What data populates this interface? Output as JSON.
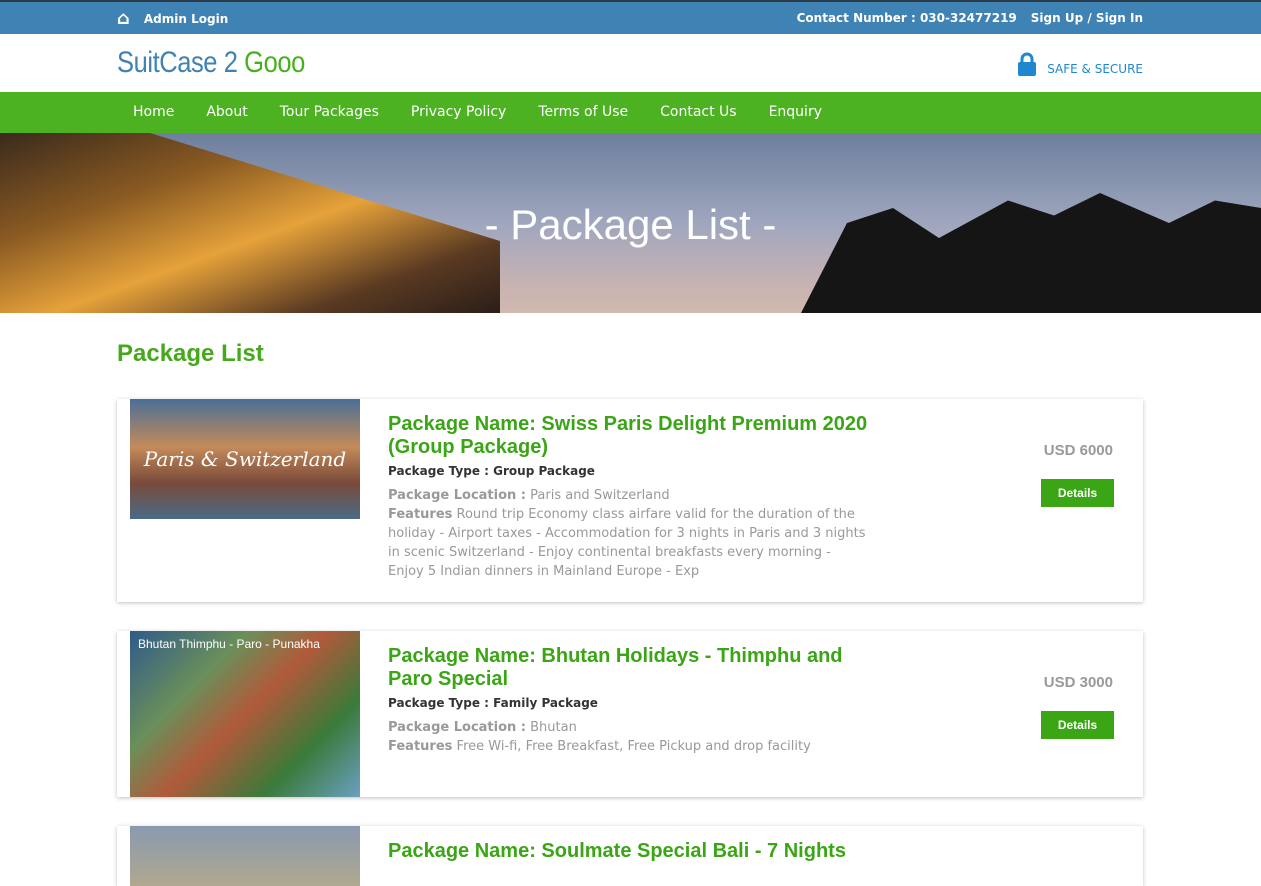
{
  "topbar": {
    "admin_login": "Admin Login",
    "contact": "Contact Number : 030-32477219",
    "signup": "Sign Up / Sign In"
  },
  "header": {
    "logo_part1": "SuitCase 2",
    "logo_part2": "Gooo",
    "secure": "SAFE & SECURE"
  },
  "nav": [
    "Home",
    "About",
    "Tour Packages",
    "Privacy Policy",
    "Terms of Use",
    "Contact Us",
    "Enquiry"
  ],
  "hero": {
    "title": "- Package List -"
  },
  "section_title": "Package List",
  "packages": [
    {
      "image_text": "Paris & Switzerland",
      "name": "Package Name: Swiss Paris Delight Premium 2020 (Group Package)",
      "type": "Package Type : Group Package",
      "location_label": "Package Location :",
      "location": "Paris and Switzerland",
      "features_label": "Features",
      "features": "Round trip Economy class airfare valid for the duration of the holiday - Airport taxes - Accommodation for 3 nights in Paris and 3 nights in scenic Switzerland - Enjoy continental breakfasts every morning - Enjoy 5 Indian dinners in Mainland Europe - Exp",
      "price": "USD 6000",
      "button": "Details"
    },
    {
      "image_text": "Bhutan Thimphu - Paro - Punakha",
      "name": "Package Name: Bhutan Holidays - Thimphu and Paro Special",
      "type": "Package Type : Family Package",
      "location_label": "Package Location :",
      "location": "Bhutan",
      "features_label": "Features",
      "features": "Free Wi-fi, Free Breakfast, Free Pickup and drop facility",
      "price": "USD 3000",
      "button": "Details"
    },
    {
      "name": "Package Name: Soulmate Special Bali - 7 Nights"
    }
  ]
}
